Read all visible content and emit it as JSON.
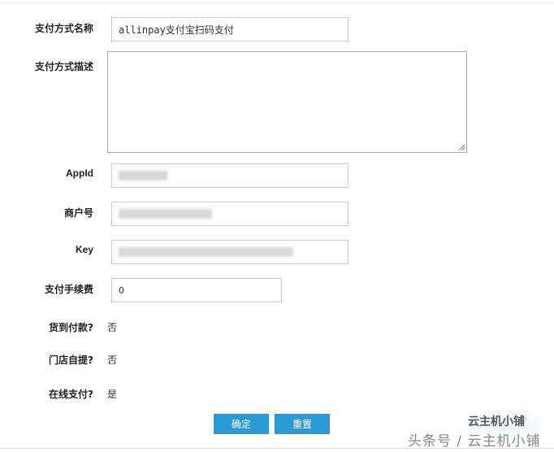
{
  "form": {
    "name_label": "支付方式名称",
    "name_value": "allinpay支付宝扫码支付",
    "desc_label": "支付方式描述",
    "desc_value": "",
    "appid_label": "AppId",
    "merchant_label": "商户号",
    "key_label": "Key",
    "fee_label": "支付手续费",
    "fee_value": "0",
    "cod_label": "货到付款?",
    "cod_value": "否",
    "pickup_label": "门店自提?",
    "pickup_value": "否",
    "online_label": "在线支付?",
    "online_value": "是"
  },
  "buttons": {
    "confirm": "确定",
    "reset": "重置"
  },
  "watermark": {
    "brand": "云主机小铺",
    "text": "头条号 / 云主机小铺"
  },
  "colors": {
    "button": "#2a9ad6"
  }
}
